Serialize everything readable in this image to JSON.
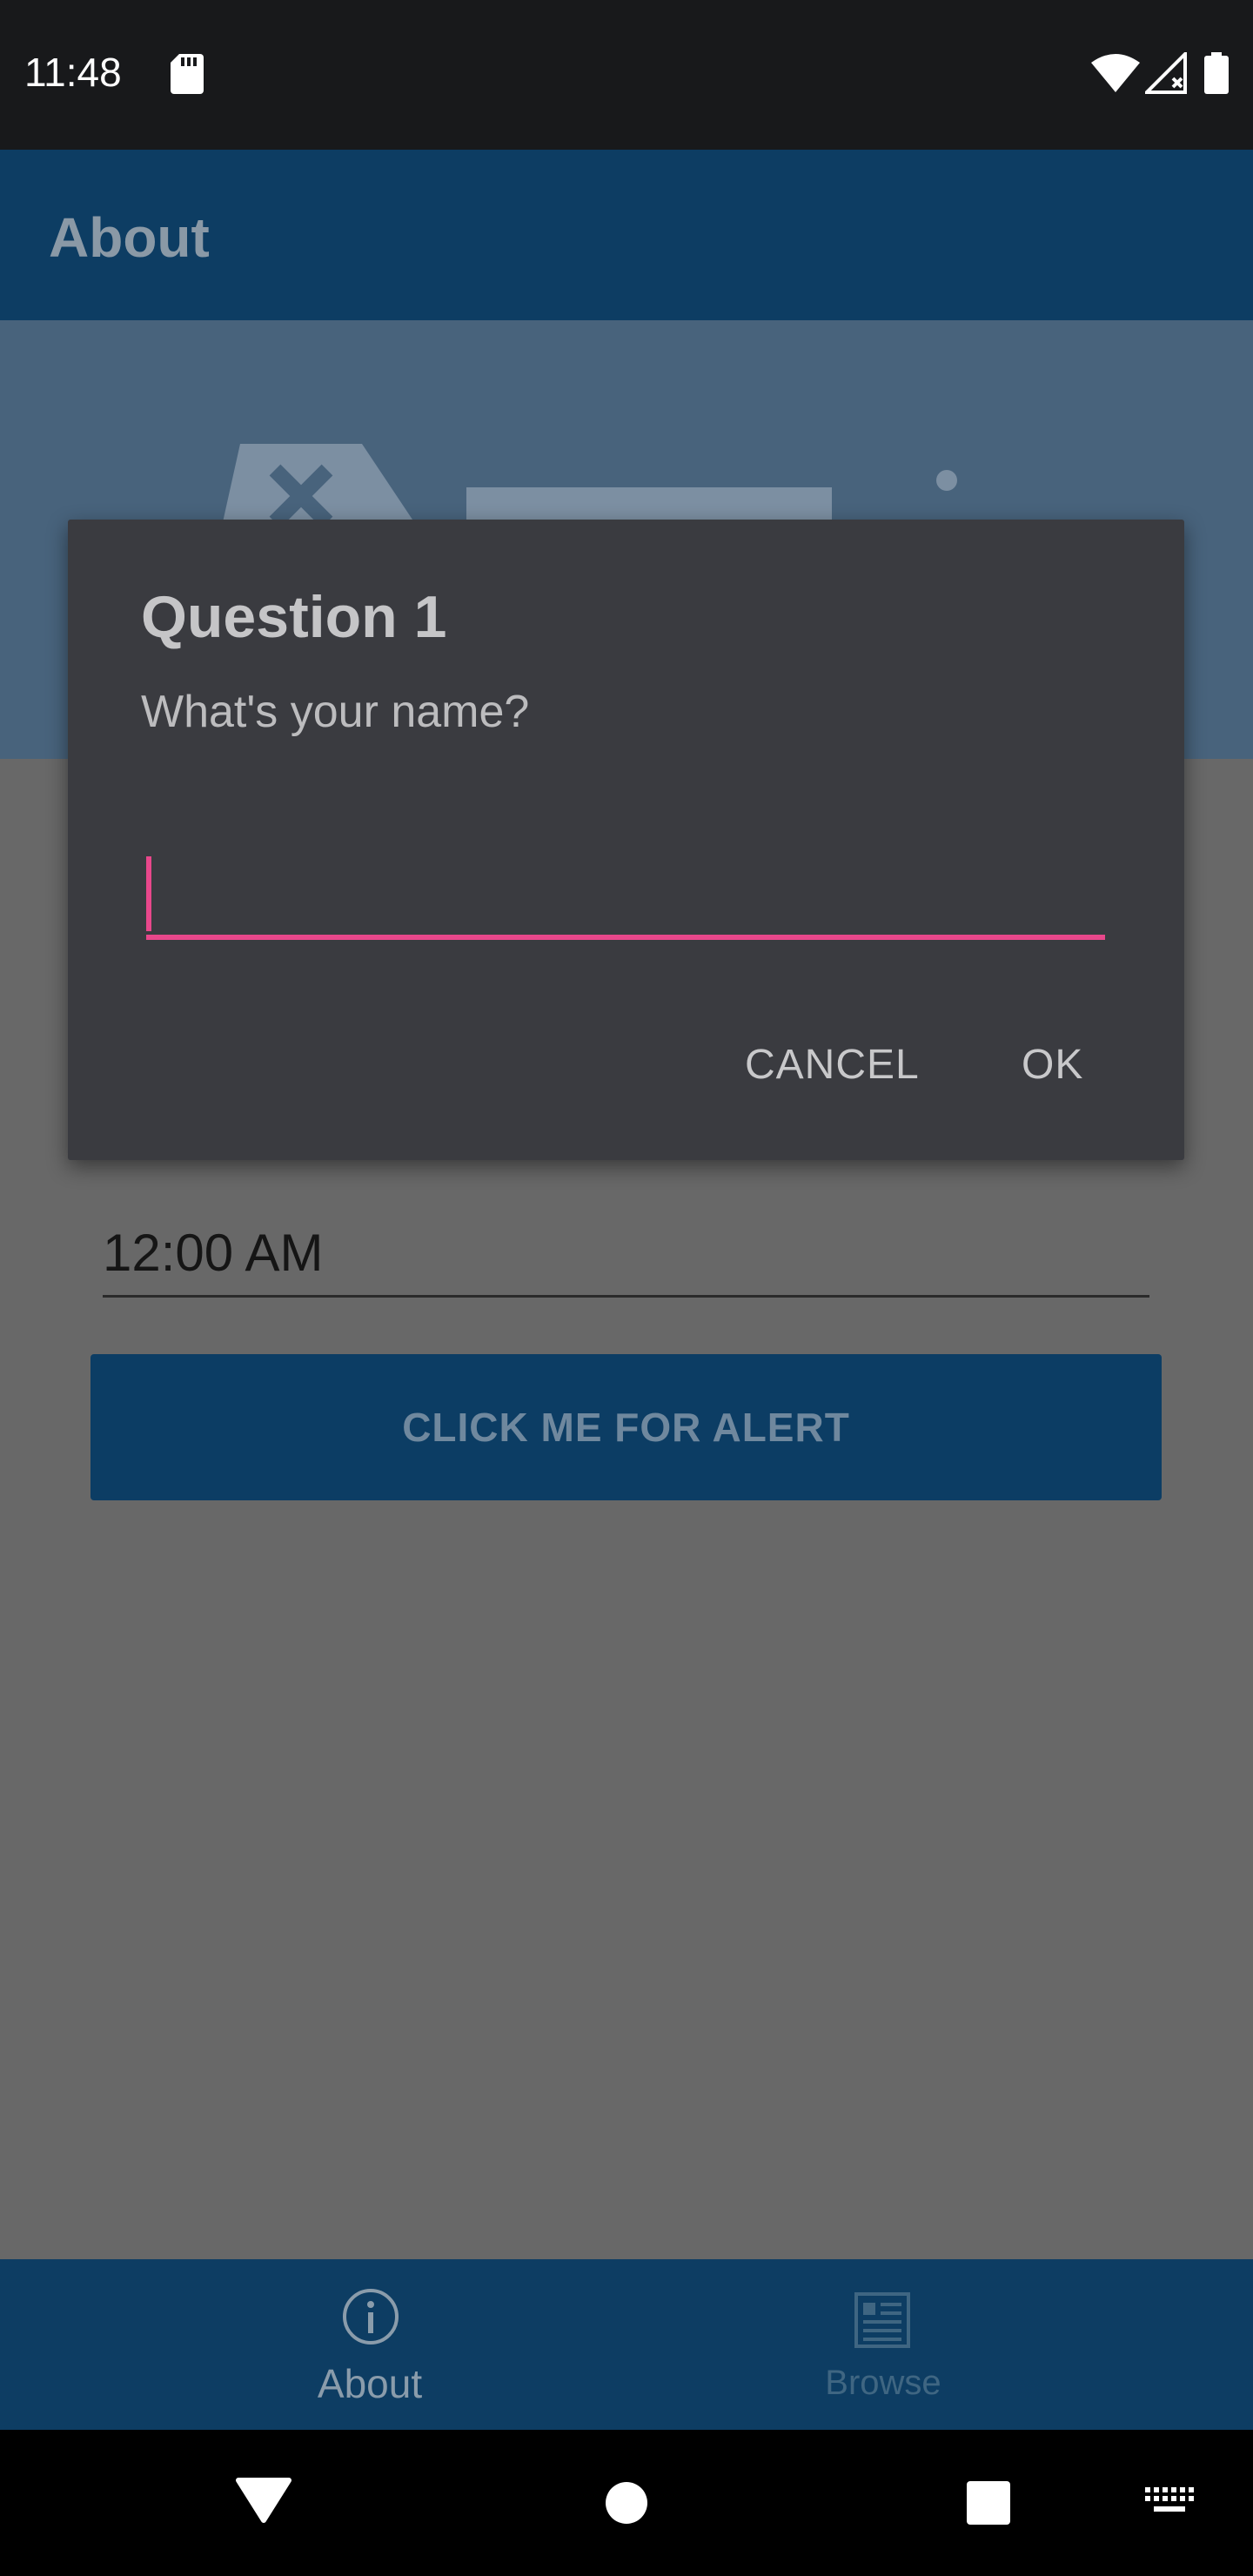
{
  "status_bar": {
    "time": "11:48",
    "icons": [
      "sd-card-icon",
      "wifi-icon",
      "cell-signal-off-icon",
      "battery-icon"
    ]
  },
  "toolbar": {
    "title": "About"
  },
  "header": {
    "logo": "xamarin-logo-icon"
  },
  "content": {
    "time_value": "12:00 AM",
    "alert_button_label": "CLICK ME FOR ALERT"
  },
  "dialog": {
    "title": "Question 1",
    "message": "What's your name?",
    "input_value": "",
    "cancel_label": "CANCEL",
    "ok_label": "OK"
  },
  "tabs": [
    {
      "label": "About",
      "icon": "info-icon",
      "selected": true
    },
    {
      "label": "Browse",
      "icon": "list-icon",
      "selected": false
    }
  ],
  "nav_bar": {
    "icons": [
      "back-icon",
      "home-icon",
      "recents-icon",
      "keyboard-icon"
    ]
  },
  "colors": {
    "accent": "#e8478b",
    "primary": "#2196f3",
    "dialog_bg": "#3a3b40",
    "scrim": "#686868"
  }
}
